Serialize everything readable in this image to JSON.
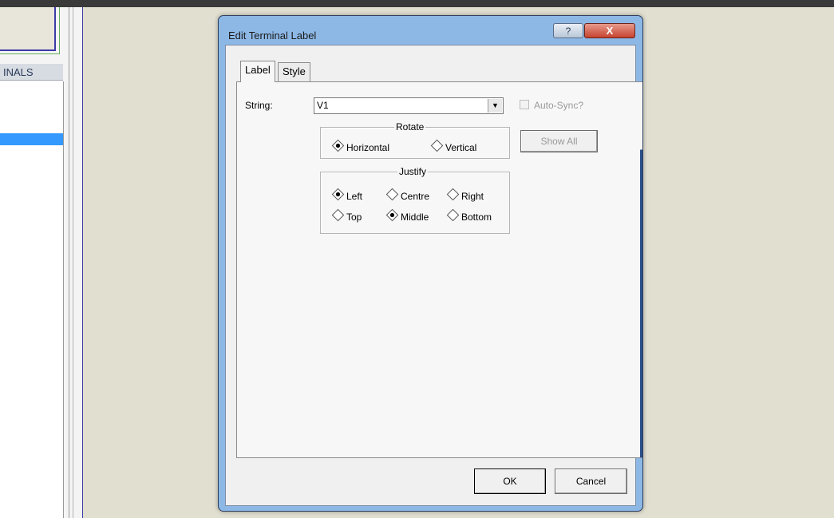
{
  "app": {
    "list_header": "INALS"
  },
  "dialog": {
    "title": "Edit Terminal Label",
    "help_button": "?",
    "close_button": "X",
    "tabs": [
      {
        "label": "Label",
        "active": true
      },
      {
        "label": "Style",
        "active": false
      }
    ],
    "string_label": "String:",
    "string_value": "V1",
    "auto_sync_label": "Auto-Sync?",
    "auto_sync_checked": false,
    "show_all_label": "Show All",
    "rotate": {
      "title": "Rotate",
      "options": [
        {
          "label": "Horizontal",
          "selected": true
        },
        {
          "label": "Vertical",
          "selected": false
        }
      ]
    },
    "justify": {
      "title": "Justify",
      "options": [
        {
          "label": "Left",
          "selected": true
        },
        {
          "label": "Centre",
          "selected": false
        },
        {
          "label": "Right",
          "selected": false
        },
        {
          "label": "Top",
          "selected": false
        },
        {
          "label": "Middle",
          "selected": true
        },
        {
          "label": "Bottom",
          "selected": false
        }
      ]
    },
    "ok_label": "OK",
    "cancel_label": "Cancel"
  },
  "colors": {
    "workspace_bg": "#e1dfd0",
    "selection": "#3399ff",
    "title_bar": "#8db8e6",
    "close_button": "#c6432f"
  }
}
